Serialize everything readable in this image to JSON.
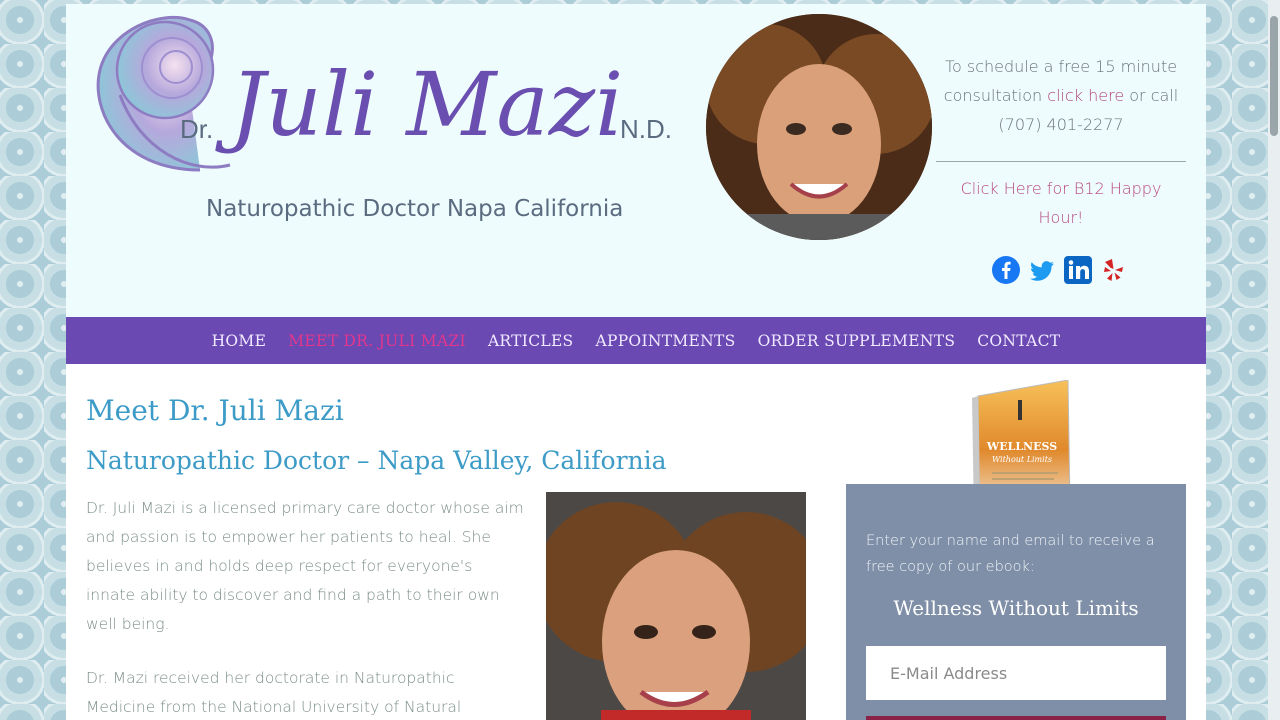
{
  "header": {
    "logo": {
      "prefix": "Dr.",
      "name": "Juli Mazi",
      "suffix": "N.D.",
      "tagline": "Naturopathic Doctor Napa California"
    },
    "contact": {
      "line1": "To schedule a free 15 minute",
      "line2_before": "consultation ",
      "line2_link": "click here",
      "line2_after": " or call",
      "phone": "(707) 401-2277",
      "b12_link": "Click Here for B12 Happy Hour!"
    },
    "social": [
      "facebook-icon",
      "twitter-icon",
      "linkedin-icon",
      "yelp-icon"
    ]
  },
  "nav": {
    "items": [
      "HOME",
      "MEET DR. JULI MAZI",
      "ARTICLES",
      "APPOINTMENTS",
      "ORDER SUPPLEMENTS",
      "CONTACT"
    ],
    "active_index": 1
  },
  "main": {
    "title": "Meet Dr. Juli Mazi",
    "subtitle": "Naturopathic Doctor – Napa Valley, California",
    "paragraph1": "Dr. Juli Mazi is a licensed primary care doctor whose aim and passion is to empower her patients to heal. She believes in and holds deep respect for everyone's innate ability to discover and find a path to their own well being.",
    "paragraph2": "Dr. Mazi received her doctorate in Naturopathic Medicine from the National University of Natural"
  },
  "sidebar": {
    "ebook_title": "WELLNESS",
    "ebook_subtitle": "Without Limits",
    "optin_text": "Enter your name and email to receive a free copy of our ebook:",
    "optin_title": "Wellness Without Limits",
    "email_placeholder": "E-Mail Address"
  },
  "colors": {
    "nav_bg": "#6a49b3",
    "nav_active": "#e3368c",
    "heading": "#3d9bc7",
    "link": "#b0457a",
    "optin_bg": "#7f8fa7",
    "header_bg": "#eefcfd"
  }
}
